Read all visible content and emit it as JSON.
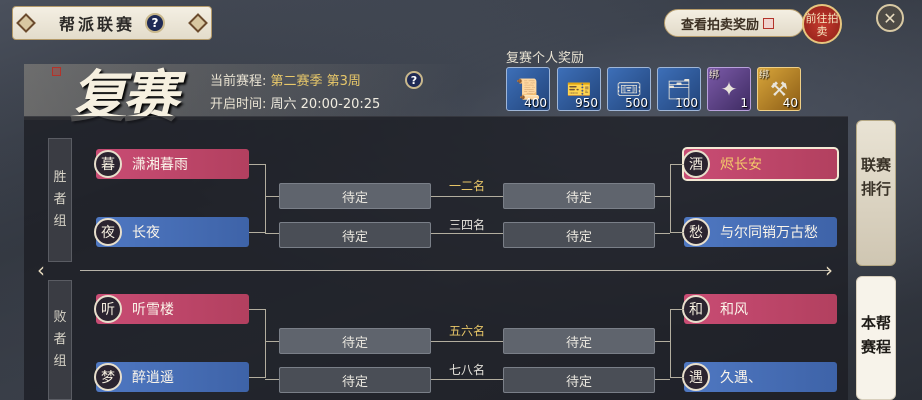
{
  "header": {
    "title": "帮派联赛",
    "help_glyph": "?",
    "auction_label": "查看拍卖奖励",
    "goto_label": "前往拍卖",
    "close_glyph": "✕"
  },
  "stage": {
    "title": "复赛",
    "schedule_label": "当前赛程:",
    "schedule_value": "第二赛季 第3周",
    "open_label": "开启时间:",
    "open_value": "周六 20:00-20:25",
    "help_glyph": "?"
  },
  "rewards": {
    "title": "复赛个人奖励",
    "items": [
      {
        "icon": "red-scroll-icon",
        "glyph": "📜",
        "qty": "400",
        "bind": "",
        "style": "blue"
      },
      {
        "icon": "gold-token-icon",
        "glyph": "🎫",
        "qty": "950",
        "bind": "",
        "style": "blue"
      },
      {
        "icon": "gold-ticket-icon",
        "glyph": "🎟",
        "qty": "500",
        "bind": "",
        "style": "blue"
      },
      {
        "icon": "blue-card-icon",
        "glyph": "🗂",
        "qty": "100",
        "bind": "",
        "style": "blue"
      },
      {
        "icon": "purple-pouch-icon",
        "glyph": "✦",
        "qty": "1",
        "bind": "绑",
        "style": "purple"
      },
      {
        "icon": "gold-hammer-icon",
        "glyph": "⚒",
        "qty": "40",
        "bind": "绑",
        "style": "gold"
      }
    ]
  },
  "groups": {
    "winners": "胜者组",
    "losers": "败者组"
  },
  "bracket": {
    "pending": "待定",
    "ranks": [
      "一二名",
      "三四名",
      "五六名",
      "七八名"
    ],
    "left": [
      {
        "badge": "暮",
        "name": "潇湘暮雨",
        "color": "pink"
      },
      {
        "badge": "夜",
        "name": "长夜",
        "color": "blue"
      },
      {
        "badge": "听",
        "name": "听雪楼",
        "color": "pink"
      },
      {
        "badge": "梦",
        "name": "醉逍遥",
        "color": "blue"
      }
    ],
    "right": [
      {
        "badge": "酒",
        "name": "烬长安",
        "color": "pink",
        "selected": true
      },
      {
        "badge": "愁",
        "name": "与尔同销万古愁",
        "color": "blue"
      },
      {
        "badge": "和",
        "name": "和风",
        "color": "pink"
      },
      {
        "badge": "遇",
        "name": "久遇、",
        "color": "blue"
      }
    ]
  },
  "tabs": {
    "ranking": "联赛排行",
    "schedule": "本帮赛程"
  },
  "colors": {
    "pink_team": "#c94c74",
    "blue_team": "#4f78c2",
    "gold_text": "#e9c768",
    "panel_bg": "#1c1e24"
  }
}
